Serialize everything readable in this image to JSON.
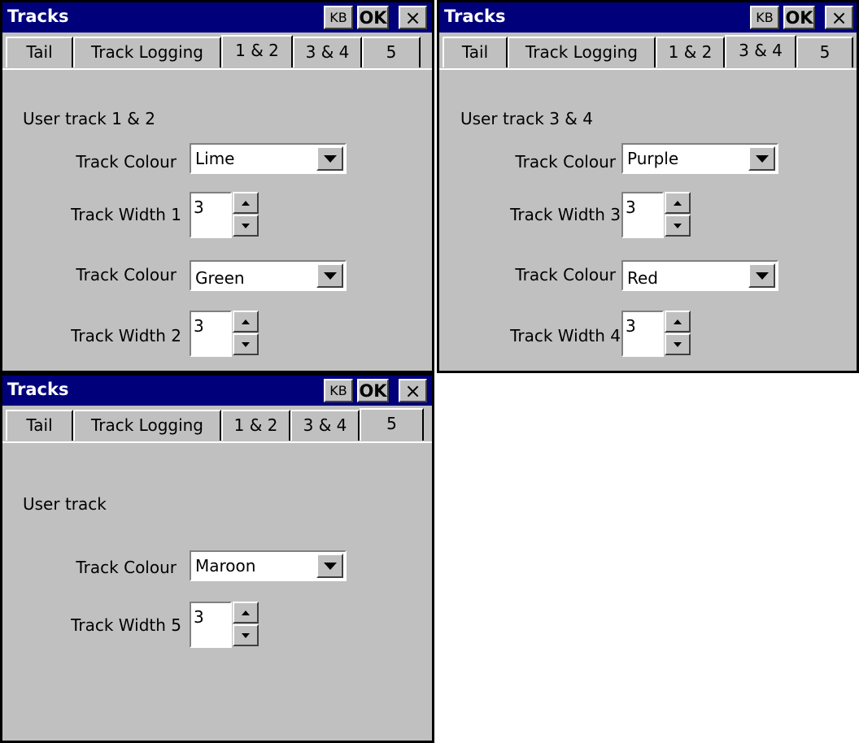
{
  "panels": [
    {
      "title": "Tracks",
      "kb_label": "KB",
      "ok_label": "OK",
      "close_label": "×",
      "tabs": [
        "Tail",
        "Track Logging",
        "1 & 2",
        "3 & 4",
        "5"
      ],
      "active_tab": "1 & 2",
      "heading": "User track 1 & 2",
      "colour_label_1": "Track Colour",
      "colour_value_1": "Lime",
      "width_label_1": "Track Width 1",
      "width_value_1": "3",
      "colour_label_2": "Track Colour",
      "colour_value_2": "Green",
      "width_label_2": "Track Width 2",
      "width_value_2": "3"
    },
    {
      "title": "Tracks",
      "kb_label": "KB",
      "ok_label": "OK",
      "close_label": "×",
      "tabs": [
        "Tail",
        "Track Logging",
        "1 & 2",
        "3 & 4",
        "5"
      ],
      "active_tab": "3 & 4",
      "heading": "User track 3 & 4",
      "colour_label_1": "Track Colour",
      "colour_value_1": "Purple",
      "width_label_1": "Track Width 3",
      "width_value_1": "3",
      "colour_label_2": "Track Colour",
      "colour_value_2": "Red",
      "width_label_2": "Track Width 4",
      "width_value_2": "3"
    },
    {
      "title": "Tracks",
      "kb_label": "KB",
      "ok_label": "OK",
      "close_label": "×",
      "tabs": [
        "Tail",
        "Track Logging",
        "1 & 2",
        "3 & 4",
        "5"
      ],
      "active_tab": "5",
      "heading": "User track",
      "colour_label_1": "Track Colour",
      "colour_value_1": "Maroon",
      "width_label_1": "Track Width 5",
      "width_value_1": "3"
    }
  ],
  "colors": {
    "titlebar": "#00007b",
    "face": "#c0c0c0"
  }
}
